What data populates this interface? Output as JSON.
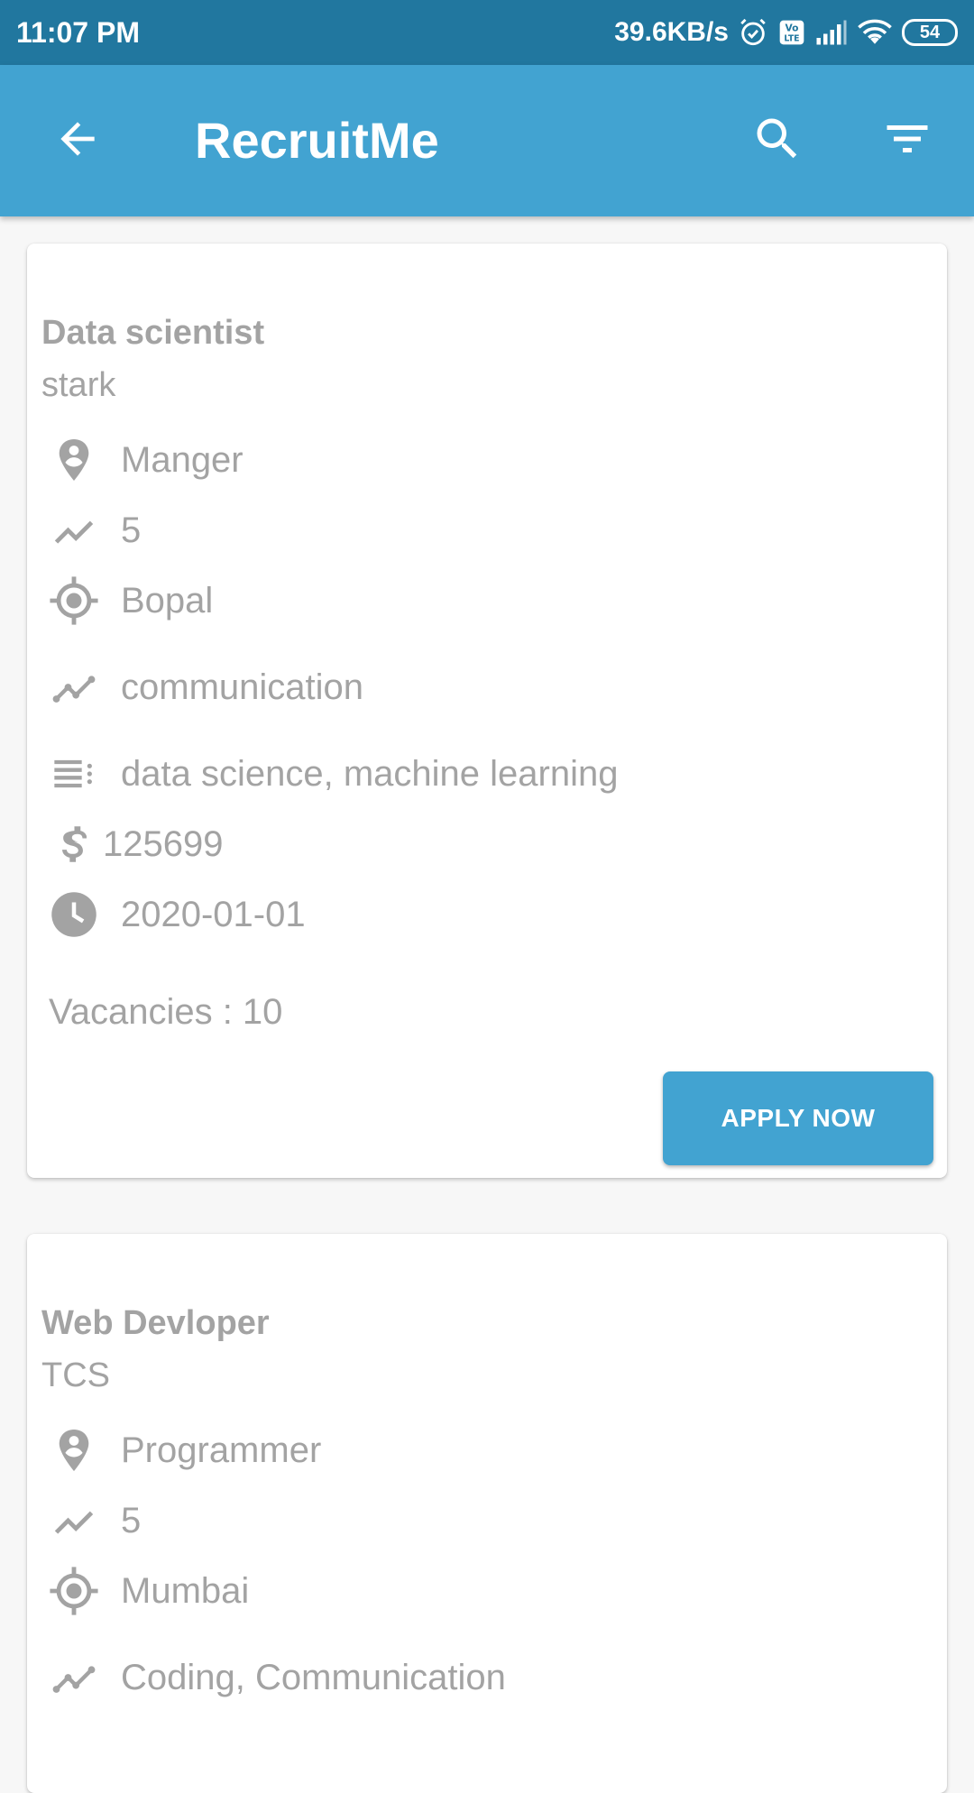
{
  "status_bar": {
    "time": "11:07 PM",
    "network_speed": "39.6KB/s",
    "battery": "54",
    "icons": [
      "alarm-icon",
      "volte-icon",
      "cell-signal-icon",
      "wifi-icon",
      "battery-icon"
    ]
  },
  "app_bar": {
    "title": "RecruitMe",
    "icons": [
      "back-arrow-icon",
      "search-icon",
      "filter-icon"
    ]
  },
  "jobs": [
    {
      "title": "Data scientist",
      "company": "stark",
      "position": "Manger",
      "experience": "5",
      "location": "Bopal",
      "skills": "communication",
      "tags": "data science, machine learning",
      "salary": "125699",
      "date": "2020-01-01",
      "vacancies": "Vacancies : 10",
      "apply_label": "APPLY NOW"
    },
    {
      "title": "Web Devloper",
      "company": "TCS",
      "position": "Programmer",
      "experience": "5",
      "location": "Mumbai",
      "skills": "Coding, Communication"
    }
  ],
  "colors": {
    "status_bar": "#21779f",
    "app_bar": "#42a3d1",
    "button": "#42a3d1",
    "text_muted": "#a3a3a3"
  }
}
